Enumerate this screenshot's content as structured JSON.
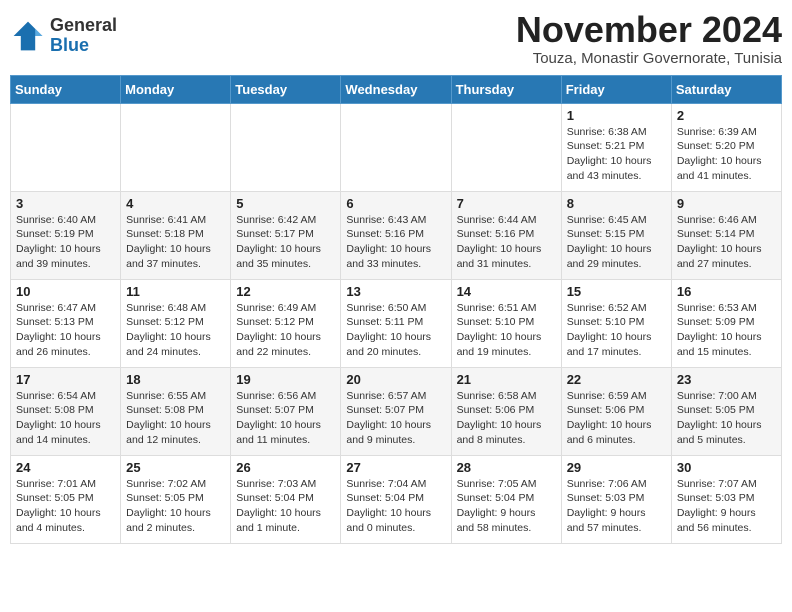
{
  "header": {
    "logo_general": "General",
    "logo_blue": "Blue",
    "month_year": "November 2024",
    "location": "Touza, Monastir Governorate, Tunisia"
  },
  "days_of_week": [
    "Sunday",
    "Monday",
    "Tuesday",
    "Wednesday",
    "Thursday",
    "Friday",
    "Saturday"
  ],
  "weeks": [
    [
      {
        "day": "",
        "info": ""
      },
      {
        "day": "",
        "info": ""
      },
      {
        "day": "",
        "info": ""
      },
      {
        "day": "",
        "info": ""
      },
      {
        "day": "",
        "info": ""
      },
      {
        "day": "1",
        "info": "Sunrise: 6:38 AM\nSunset: 5:21 PM\nDaylight: 10 hours and 43 minutes."
      },
      {
        "day": "2",
        "info": "Sunrise: 6:39 AM\nSunset: 5:20 PM\nDaylight: 10 hours and 41 minutes."
      }
    ],
    [
      {
        "day": "3",
        "info": "Sunrise: 6:40 AM\nSunset: 5:19 PM\nDaylight: 10 hours and 39 minutes."
      },
      {
        "day": "4",
        "info": "Sunrise: 6:41 AM\nSunset: 5:18 PM\nDaylight: 10 hours and 37 minutes."
      },
      {
        "day": "5",
        "info": "Sunrise: 6:42 AM\nSunset: 5:17 PM\nDaylight: 10 hours and 35 minutes."
      },
      {
        "day": "6",
        "info": "Sunrise: 6:43 AM\nSunset: 5:16 PM\nDaylight: 10 hours and 33 minutes."
      },
      {
        "day": "7",
        "info": "Sunrise: 6:44 AM\nSunset: 5:16 PM\nDaylight: 10 hours and 31 minutes."
      },
      {
        "day": "8",
        "info": "Sunrise: 6:45 AM\nSunset: 5:15 PM\nDaylight: 10 hours and 29 minutes."
      },
      {
        "day": "9",
        "info": "Sunrise: 6:46 AM\nSunset: 5:14 PM\nDaylight: 10 hours and 27 minutes."
      }
    ],
    [
      {
        "day": "10",
        "info": "Sunrise: 6:47 AM\nSunset: 5:13 PM\nDaylight: 10 hours and 26 minutes."
      },
      {
        "day": "11",
        "info": "Sunrise: 6:48 AM\nSunset: 5:12 PM\nDaylight: 10 hours and 24 minutes."
      },
      {
        "day": "12",
        "info": "Sunrise: 6:49 AM\nSunset: 5:12 PM\nDaylight: 10 hours and 22 minutes."
      },
      {
        "day": "13",
        "info": "Sunrise: 6:50 AM\nSunset: 5:11 PM\nDaylight: 10 hours and 20 minutes."
      },
      {
        "day": "14",
        "info": "Sunrise: 6:51 AM\nSunset: 5:10 PM\nDaylight: 10 hours and 19 minutes."
      },
      {
        "day": "15",
        "info": "Sunrise: 6:52 AM\nSunset: 5:10 PM\nDaylight: 10 hours and 17 minutes."
      },
      {
        "day": "16",
        "info": "Sunrise: 6:53 AM\nSunset: 5:09 PM\nDaylight: 10 hours and 15 minutes."
      }
    ],
    [
      {
        "day": "17",
        "info": "Sunrise: 6:54 AM\nSunset: 5:08 PM\nDaylight: 10 hours and 14 minutes."
      },
      {
        "day": "18",
        "info": "Sunrise: 6:55 AM\nSunset: 5:08 PM\nDaylight: 10 hours and 12 minutes."
      },
      {
        "day": "19",
        "info": "Sunrise: 6:56 AM\nSunset: 5:07 PM\nDaylight: 10 hours and 11 minutes."
      },
      {
        "day": "20",
        "info": "Sunrise: 6:57 AM\nSunset: 5:07 PM\nDaylight: 10 hours and 9 minutes."
      },
      {
        "day": "21",
        "info": "Sunrise: 6:58 AM\nSunset: 5:06 PM\nDaylight: 10 hours and 8 minutes."
      },
      {
        "day": "22",
        "info": "Sunrise: 6:59 AM\nSunset: 5:06 PM\nDaylight: 10 hours and 6 minutes."
      },
      {
        "day": "23",
        "info": "Sunrise: 7:00 AM\nSunset: 5:05 PM\nDaylight: 10 hours and 5 minutes."
      }
    ],
    [
      {
        "day": "24",
        "info": "Sunrise: 7:01 AM\nSunset: 5:05 PM\nDaylight: 10 hours and 4 minutes."
      },
      {
        "day": "25",
        "info": "Sunrise: 7:02 AM\nSunset: 5:05 PM\nDaylight: 10 hours and 2 minutes."
      },
      {
        "day": "26",
        "info": "Sunrise: 7:03 AM\nSunset: 5:04 PM\nDaylight: 10 hours and 1 minute."
      },
      {
        "day": "27",
        "info": "Sunrise: 7:04 AM\nSunset: 5:04 PM\nDaylight: 10 hours and 0 minutes."
      },
      {
        "day": "28",
        "info": "Sunrise: 7:05 AM\nSunset: 5:04 PM\nDaylight: 9 hours and 58 minutes."
      },
      {
        "day": "29",
        "info": "Sunrise: 7:06 AM\nSunset: 5:03 PM\nDaylight: 9 hours and 57 minutes."
      },
      {
        "day": "30",
        "info": "Sunrise: 7:07 AM\nSunset: 5:03 PM\nDaylight: 9 hours and 56 minutes."
      }
    ]
  ]
}
